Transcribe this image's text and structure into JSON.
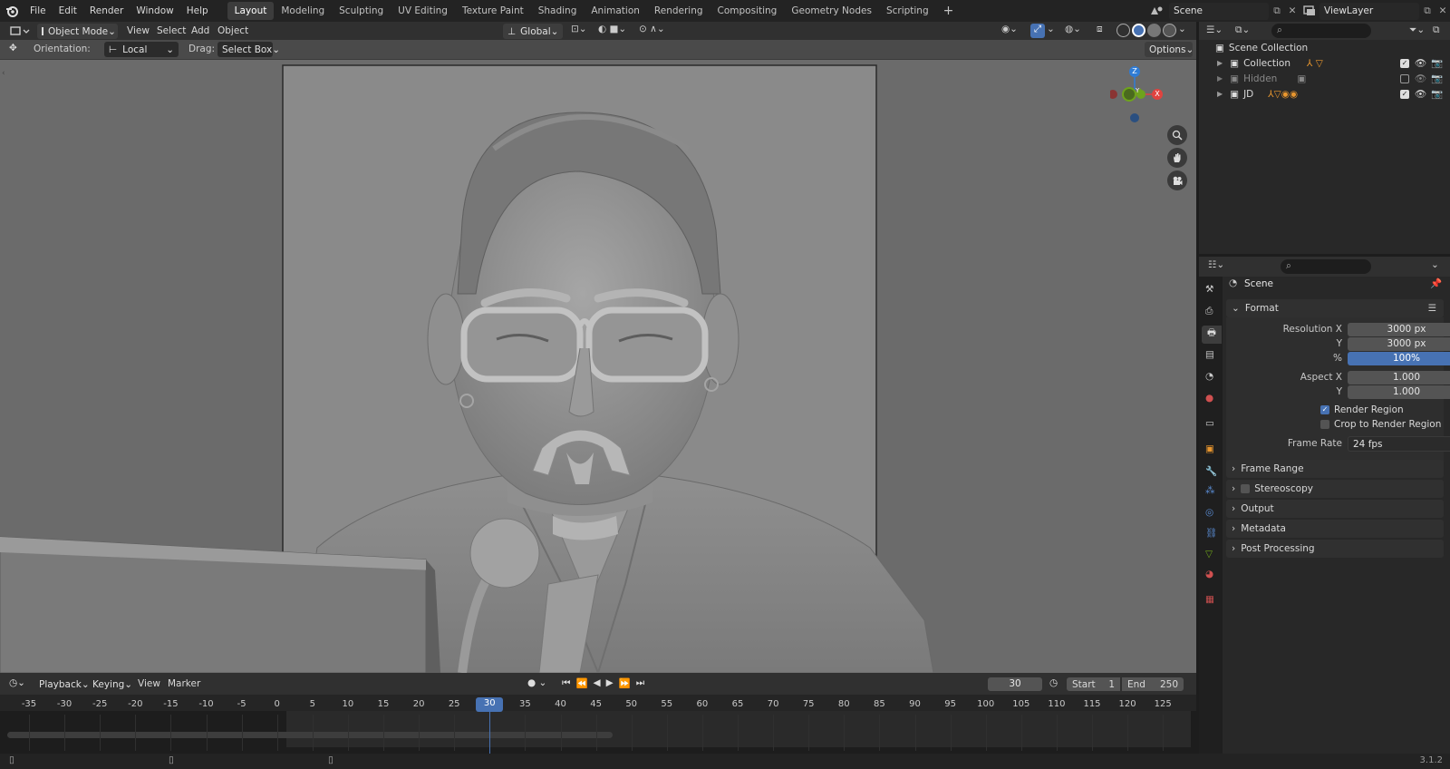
{
  "topbar": {
    "menus": [
      "File",
      "Edit",
      "Render",
      "Window",
      "Help"
    ],
    "workspaces": [
      "Layout",
      "Modeling",
      "Sculpting",
      "UV Editing",
      "Texture Paint",
      "Shading",
      "Animation",
      "Rendering",
      "Compositing",
      "Geometry Nodes",
      "Scripting"
    ],
    "active_workspace": "Layout",
    "add_tab": "+",
    "scene": "Scene",
    "view_layer": "ViewLayer"
  },
  "viewport": {
    "mode": "Object Mode",
    "menus": [
      "View",
      "Select",
      "Add",
      "Object"
    ],
    "transform_orientation": "Global",
    "tool": {
      "orientation_label": "Orientation:",
      "orientation_value": "Local",
      "drag_label": "Drag:",
      "drag_value": "Select Box",
      "options": "Options"
    },
    "gizmo": {
      "x": "X",
      "y": "Y",
      "z": "Z"
    }
  },
  "outliner": {
    "root": "Scene Collection",
    "items": [
      {
        "name": "Collection",
        "checked": true
      },
      {
        "name": "Hidden",
        "checked": false
      },
      {
        "name": "JD",
        "checked": true
      }
    ]
  },
  "properties": {
    "context": "Scene",
    "format": {
      "title": "Format",
      "resolution_x_label": "Resolution X",
      "resolution_x": "3000 px",
      "y_label": "Y",
      "resolution_y": "3000 px",
      "pct_label": "%",
      "resolution_pct": "100%",
      "aspect_x_label": "Aspect X",
      "aspect_x": "1.000",
      "aspect_y_label": "Y",
      "aspect_y": "1.000",
      "render_region": "Render Region",
      "render_region_checked": true,
      "crop_region": "Crop to Render Region",
      "crop_region_checked": false,
      "frame_rate_label": "Frame Rate",
      "frame_rate": "24 fps"
    },
    "panels": [
      "Frame Range",
      "Stereoscopy",
      "Output",
      "Metadata",
      "Post Processing"
    ]
  },
  "timeline": {
    "menus": [
      "Playback",
      "Keying",
      "View",
      "Marker"
    ],
    "current_frame": "30",
    "start_label": "Start",
    "start": "1",
    "end_label": "End",
    "end": "250",
    "ruler": [
      "-35",
      "-30",
      "-25",
      "-20",
      "-15",
      "-10",
      "-5",
      "0",
      "5",
      "10",
      "15",
      "20",
      "25",
      "30",
      "35",
      "40",
      "45",
      "50",
      "55",
      "60",
      "65",
      "70",
      "75",
      "80",
      "85",
      "90",
      "95",
      "100",
      "105",
      "110",
      "115",
      "120",
      "125"
    ],
    "playhead": "30"
  },
  "status": {
    "version": "3.1.2"
  },
  "colors": {
    "accent": "#4772b3",
    "viewport_bg": "#6b6b6b",
    "camera_frame": "#8e8e8e",
    "panel_bg": "#282828",
    "gizmo_x": "#e0433f",
    "gizmo_y": "#6ea31c",
    "gizmo_z": "#2f7cd6"
  }
}
